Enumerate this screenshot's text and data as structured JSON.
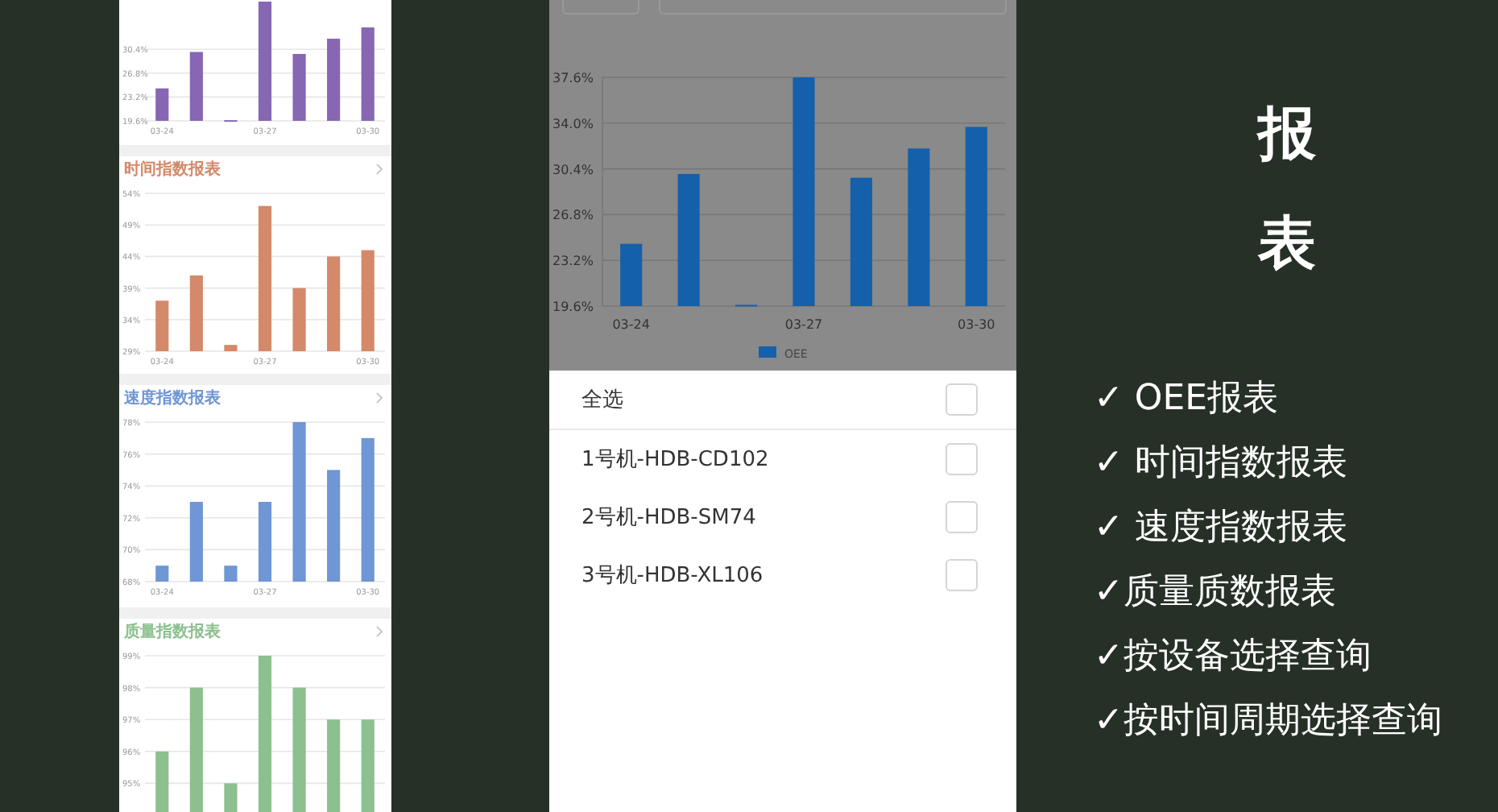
{
  "left_screen": {
    "cards": [
      {
        "chart_data": {
          "type": "bar",
          "categories": [
            "03-24",
            null,
            null,
            "03-27",
            null,
            null,
            "03-30"
          ],
          "grid": true,
          "ylim": [
            19.6,
            37.6
          ],
          "yticks": [
            {
              "value": 30.4,
              "label": "30.4%"
            },
            {
              "value": 26.8,
              "label": "26.8%"
            },
            {
              "value": 23.2,
              "label": "23.2%"
            },
            {
              "value": 19.6,
              "label": "19.6%"
            }
          ],
          "series": [
            {
              "color": "#8766b4",
              "values": [
                24.5,
                30.0,
                19.7,
                37.6,
                29.7,
                32.0,
                33.7
              ]
            }
          ]
        }
      },
      {
        "title": "时间指数报表",
        "chart_data": {
          "type": "bar",
          "categories": [
            "03-24",
            null,
            null,
            "03-27",
            null,
            null,
            "03-30"
          ],
          "grid": true,
          "ylim": [
            29,
            54
          ],
          "yticks": [
            {
              "value": 54,
              "label": "54%"
            },
            {
              "value": 49,
              "label": "49%"
            },
            {
              "value": 44,
              "label": "44%"
            },
            {
              "value": 39,
              "label": "39%"
            },
            {
              "value": 34,
              "label": "34%"
            },
            {
              "value": 29,
              "label": "29%"
            }
          ],
          "series": [
            {
              "color": "#d4896a",
              "values": [
                37,
                41,
                30,
                52,
                39,
                44,
                45
              ]
            }
          ]
        }
      },
      {
        "title": "速度指数报表",
        "chart_data": {
          "type": "bar",
          "categories": [
            "03-24",
            null,
            null,
            "03-27",
            null,
            null,
            "03-30"
          ],
          "grid": true,
          "ylim": [
            68,
            78
          ],
          "yticks": [
            {
              "value": 78,
              "label": "78%"
            },
            {
              "value": 76,
              "label": "76%"
            },
            {
              "value": 74,
              "label": "74%"
            },
            {
              "value": 72,
              "label": "72%"
            },
            {
              "value": 70,
              "label": "70%"
            },
            {
              "value": 68,
              "label": "68%"
            }
          ],
          "series": [
            {
              "color": "#6f96d5",
              "values": [
                69,
                73,
                69,
                73,
                78,
                75,
                77
              ]
            }
          ]
        }
      },
      {
        "title": "质量指数报表",
        "chart_data": {
          "type": "bar",
          "categories": [
            null,
            null,
            null,
            null,
            null,
            null,
            null
          ],
          "grid": true,
          "ylim": [
            94,
            99
          ],
          "yticks": [
            {
              "value": 99,
              "label": "99%"
            },
            {
              "value": 98,
              "label": "98%"
            },
            {
              "value": 97,
              "label": "97%"
            },
            {
              "value": 96,
              "label": "96%"
            },
            {
              "value": 95,
              "label": "95%"
            }
          ],
          "series": [
            {
              "color": "#8cc08f",
              "values": [
                96,
                98,
                95,
                99,
                98,
                97,
                97
              ]
            }
          ]
        }
      }
    ]
  },
  "middle_screen": {
    "chart_data": {
      "type": "bar",
      "categories": [
        "03-24",
        null,
        null,
        "03-27",
        null,
        null,
        "03-30"
      ],
      "grid": true,
      "ylim": [
        19.6,
        37.6
      ],
      "yticks": [
        {
          "value": 37.6,
          "label": "37.6%"
        },
        {
          "value": 34.0,
          "label": "34.0%"
        },
        {
          "value": 30.4,
          "label": "30.4%"
        },
        {
          "value": 26.8,
          "label": "26.8%"
        },
        {
          "value": 23.2,
          "label": "23.2%"
        },
        {
          "value": 19.6,
          "label": "19.6%"
        }
      ],
      "series": [
        {
          "name": "OEE",
          "color": "#1560ab",
          "values": [
            24.5,
            30.0,
            19.7,
            37.6,
            29.7,
            32.0,
            33.7
          ]
        }
      ]
    },
    "sheet": {
      "select_all": {
        "label": "全选",
        "checked": false
      },
      "devices": [
        {
          "label": "1号机-HDB-CD102",
          "checked": false
        },
        {
          "label": "2号机-HDB-SM74",
          "checked": false
        },
        {
          "label": "3号机-HDB-XL106",
          "checked": false
        }
      ]
    }
  },
  "heading": "报表",
  "features": [
    "✓ OEE报表",
    "✓ 时间指数报表",
    "✓ 速度指数报表",
    "✓质量质数报表",
    "✓按设备选择查询",
    "✓按时间周期选择查询"
  ]
}
